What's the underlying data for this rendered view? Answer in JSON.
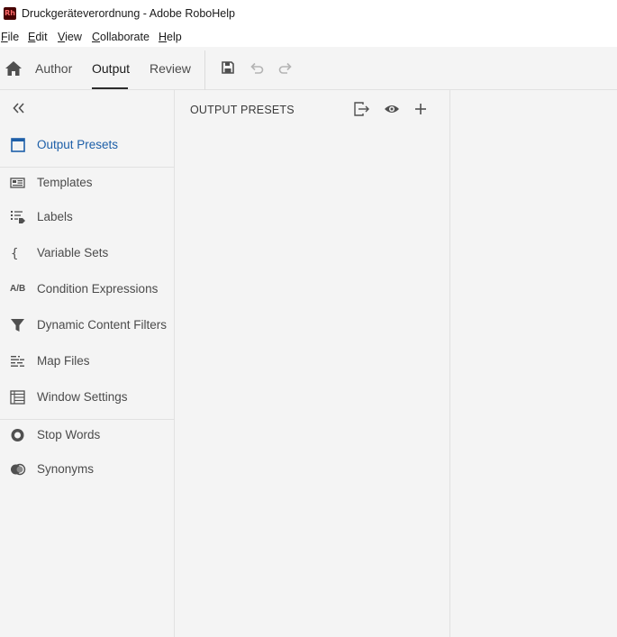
{
  "window": {
    "app_logo_text": "Rh",
    "title": "Druckgeräteverordnung - Adobe RoboHelp"
  },
  "menu": [
    {
      "underline": "F",
      "rest": "ile"
    },
    {
      "underline": "E",
      "rest": "dit"
    },
    {
      "underline": "V",
      "rest": "iew"
    },
    {
      "underline": "C",
      "rest": "ollaborate"
    },
    {
      "underline": "H",
      "rest": "elp"
    }
  ],
  "toolbar": {
    "tabs": [
      "Author",
      "Output",
      "Review"
    ],
    "active_tab": "Output",
    "icons": [
      "home-icon",
      "save-icon",
      "undo-icon",
      "redo-icon"
    ]
  },
  "sidebar": {
    "items": [
      {
        "label": "Output Presets",
        "icon": "output-presets-icon",
        "active": true
      },
      {
        "label": "Templates",
        "icon": "templates-icon"
      },
      {
        "label": "Labels",
        "icon": "labels-icon"
      },
      {
        "label": "Variable Sets",
        "icon": "braces-icon"
      },
      {
        "label": "Condition Expressions",
        "icon": "ab-icon"
      },
      {
        "label": "Dynamic Content Filters",
        "icon": "filter-icon"
      },
      {
        "label": "Map Files",
        "icon": "map-files-icon"
      },
      {
        "label": "Window Settings",
        "icon": "window-settings-icon"
      },
      {
        "label": "Stop Words",
        "icon": "stop-words-icon"
      },
      {
        "label": "Synonyms",
        "icon": "synonyms-icon"
      }
    ],
    "ab_icon_text": "A/B"
  },
  "panel": {
    "title": "OUTPUT PRESETS",
    "icons": [
      "export-icon",
      "preview-icon",
      "add-icon"
    ]
  },
  "colors": {
    "accent": "#1d5fa8",
    "background": "#f4f4f4",
    "logo_bg": "#470000",
    "logo_fg": "#ff6a6a"
  }
}
